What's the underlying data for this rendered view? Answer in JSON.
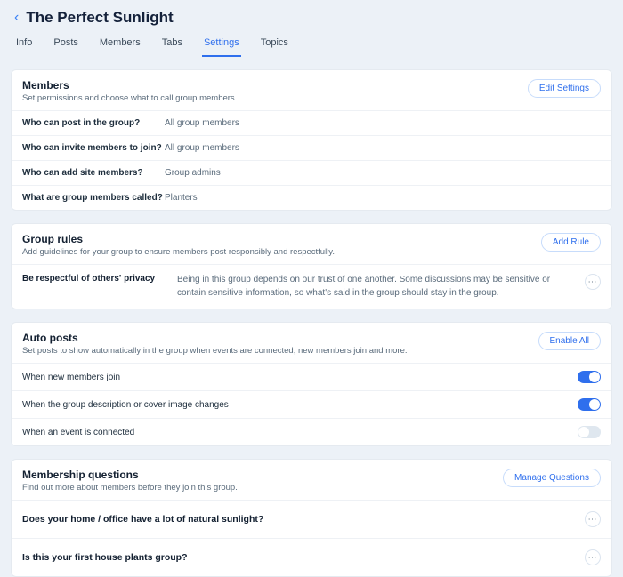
{
  "header": {
    "title": "The Perfect Sunlight"
  },
  "tabs": [
    "Info",
    "Posts",
    "Members",
    "Tabs",
    "Settings",
    "Topics"
  ],
  "active_tab_index": 4,
  "members": {
    "title": "Members",
    "desc": "Set permissions and choose what to call group members.",
    "button": "Edit Settings",
    "rows": [
      {
        "label": "Who can post in the group?",
        "value": "All group members"
      },
      {
        "label": "Who can invite members to join?",
        "value": "All group members"
      },
      {
        "label": "Who can add site members?",
        "value": "Group admins"
      },
      {
        "label": "What are group members called?",
        "value": "Planters"
      }
    ]
  },
  "rules": {
    "title": "Group rules",
    "desc": "Add guidelines for your group to ensure members post responsibly and respectfully.",
    "button": "Add Rule",
    "items": [
      {
        "title": "Be respectful of others' privacy",
        "body": "Being in this group depends on our trust of one another. Some discussions may be sensitive or contain sensitive information, so what's said in the group should stay in the group."
      }
    ]
  },
  "auto": {
    "title": "Auto posts",
    "desc": "Set posts to show automatically in the group when events are connected, new members join and more.",
    "button": "Enable All",
    "items": [
      {
        "label": "When new members join",
        "on": true
      },
      {
        "label": "When the group description or cover image changes",
        "on": true
      },
      {
        "label": "When an event is connected",
        "on": false
      }
    ]
  },
  "questions": {
    "title": "Membership questions",
    "desc": "Find out more about members before they join this group.",
    "button": "Manage Questions",
    "items": [
      "Does your home / office have a lot of natural sunlight?",
      "Is this your first house plants group?"
    ]
  }
}
